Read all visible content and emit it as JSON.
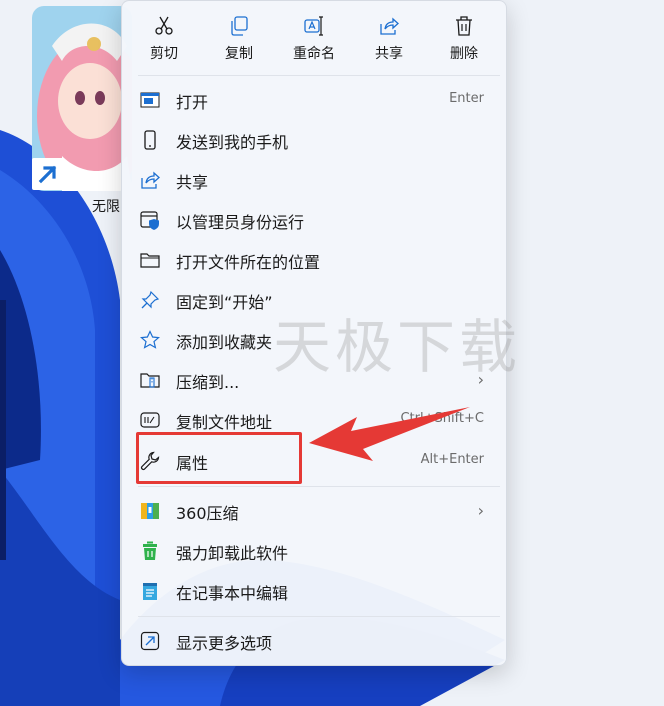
{
  "desktop": {
    "shortcut_label": "无限"
  },
  "quick_actions": [
    {
      "label": "剪切",
      "icon": "scissors-icon"
    },
    {
      "label": "复制",
      "icon": "copy-icon"
    },
    {
      "label": "重命名",
      "icon": "rename-icon"
    },
    {
      "label": "共享",
      "icon": "share-icon"
    },
    {
      "label": "删除",
      "icon": "trash-icon"
    }
  ],
  "menu_items": [
    {
      "label": "打开",
      "shortcut": "Enter",
      "icon": "open-window-icon"
    },
    {
      "label": "发送到我的手机",
      "icon": "phone-icon"
    },
    {
      "label": "共享",
      "icon": "share-icon"
    },
    {
      "label": "以管理员身份运行",
      "icon": "admin-shield-icon"
    },
    {
      "label": "打开文件所在的位置",
      "icon": "folder-icon"
    },
    {
      "label": "固定到“开始”",
      "icon": "pin-icon"
    },
    {
      "label": "添加到收藏夹",
      "icon": "star-icon"
    },
    {
      "label": "压缩到...",
      "icon": "zip-folder-icon",
      "submenu": true
    },
    {
      "label": "复制文件地址",
      "shortcut": "Ctrl+Shift+C",
      "icon": "copy-path-icon"
    },
    {
      "label": "属性",
      "shortcut": "Alt+Enter",
      "icon": "wrench-icon"
    },
    {
      "label": "360压缩",
      "icon": "360-zip-icon",
      "submenu": true
    },
    {
      "label": "强力卸载此软件",
      "icon": "uninstall-icon"
    },
    {
      "label": "在记事本中编辑",
      "icon": "notepad-icon"
    },
    {
      "label": "显示更多选项",
      "icon": "more-options-icon"
    }
  ],
  "submenu_glyph": "›",
  "watermark": "天极下载",
  "colors": {
    "accent_blue": "#1c6fd1",
    "highlight_red": "#e53935",
    "wallpaper_blue": "#1e4fd6"
  }
}
